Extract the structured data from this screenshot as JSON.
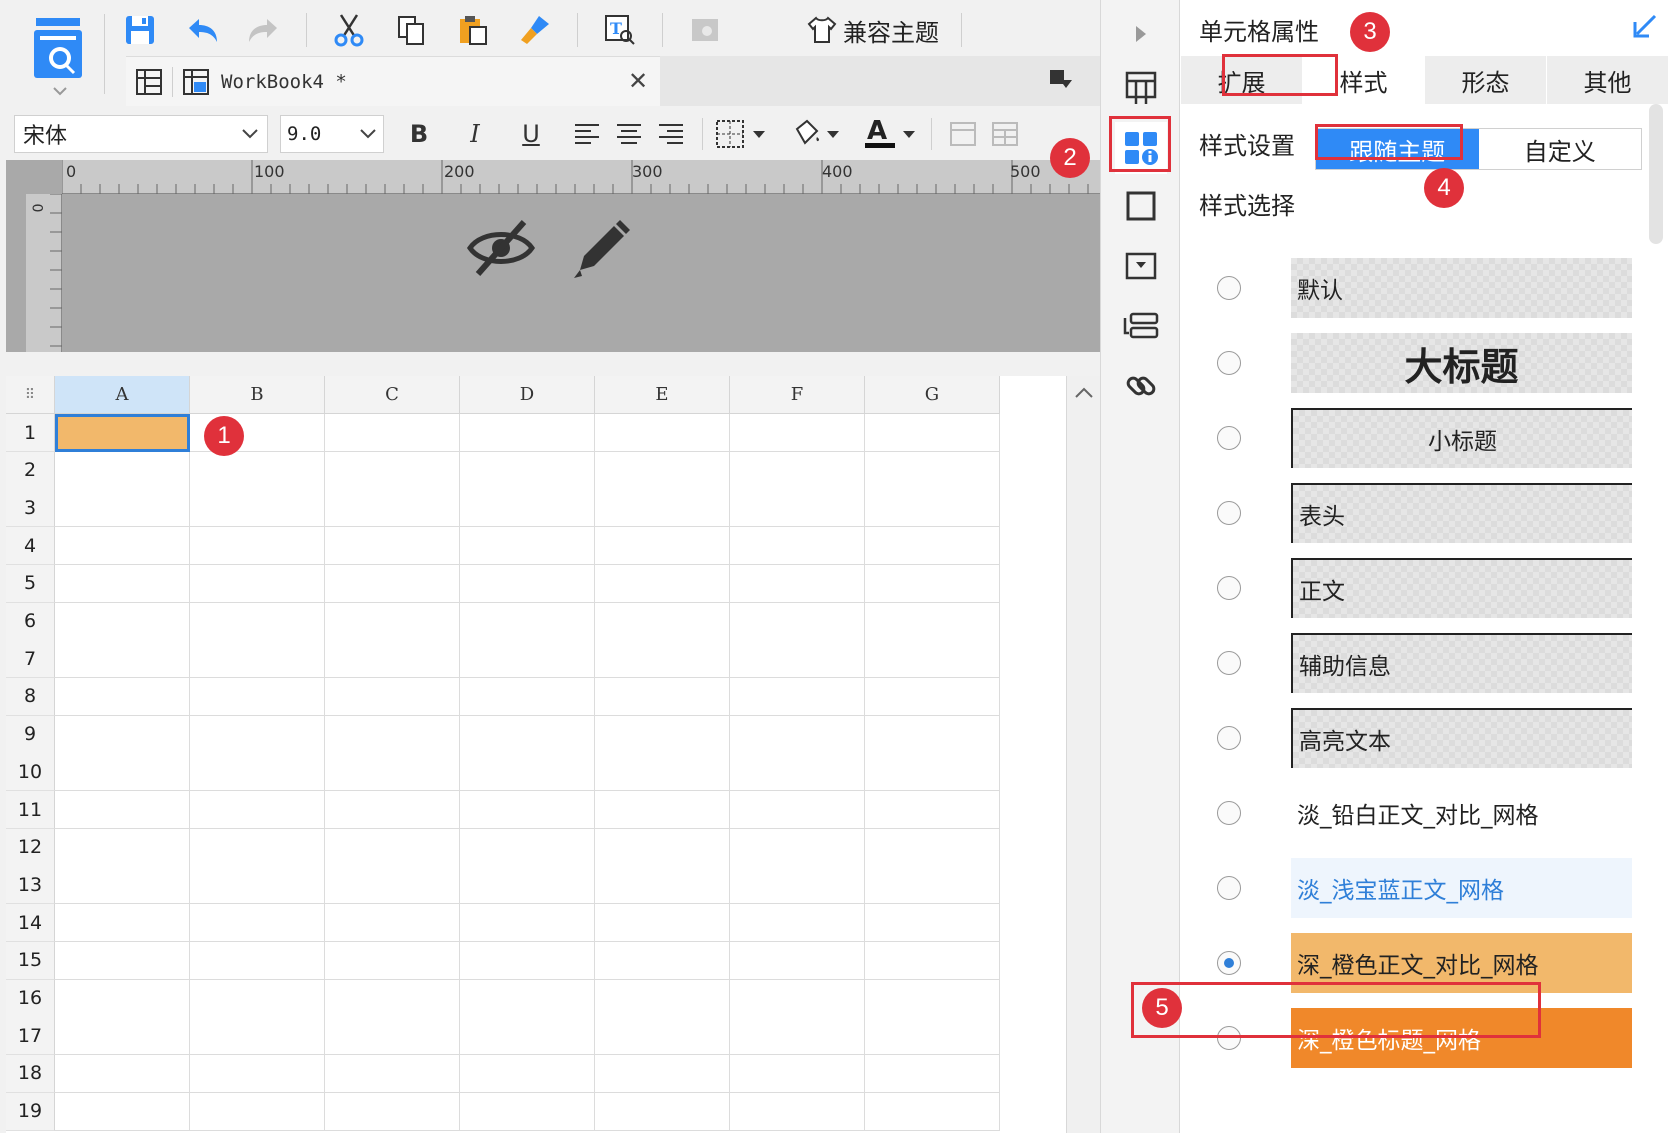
{
  "toolbar": {
    "theme_label": "兼容主题"
  },
  "tab": {
    "name": "WorkBook4 *"
  },
  "format": {
    "font_name": "宋体",
    "font_size": "9.0",
    "bold": "B",
    "italic": "I",
    "underline": "U",
    "font_color_glyph": "A"
  },
  "ruler": {
    "h_ticks": [
      "0",
      "100",
      "200",
      "300",
      "400",
      "500"
    ],
    "v_zero": "0"
  },
  "grid": {
    "columns": [
      "A",
      "B",
      "C",
      "D",
      "E",
      "F",
      "G"
    ],
    "rows": [
      "1",
      "2",
      "3",
      "4",
      "5",
      "6",
      "7",
      "8",
      "9",
      "10",
      "11",
      "12",
      "13",
      "14",
      "15",
      "16",
      "17",
      "18",
      "19"
    ],
    "selected_cell_color": "#f2b86b"
  },
  "panel": {
    "title": "单元格属性",
    "tabs": [
      "扩展",
      "样式",
      "形态",
      "其他"
    ],
    "active_tab": "样式",
    "style_setting_label": "样式设置",
    "style_setting_options": [
      "跟随主题",
      "自定义"
    ],
    "style_setting_selected": "跟随主题",
    "style_choice_label": "样式选择",
    "styles": [
      {
        "label": "默认",
        "selected": false
      },
      {
        "label": "大标题",
        "selected": false
      },
      {
        "label": "小标题",
        "selected": false
      },
      {
        "label": "表头",
        "selected": false
      },
      {
        "label": "正文",
        "selected": false
      },
      {
        "label": "辅助信息",
        "selected": false
      },
      {
        "label": "高亮文本",
        "selected": false
      },
      {
        "label": "淡_铅白正文_对比_网格",
        "selected": false
      },
      {
        "label": "淡_浅宝蓝正文_网格",
        "selected": false
      },
      {
        "label": "深_橙色正文_对比_网格",
        "selected": true
      },
      {
        "label": "深_橙色标题_网格",
        "selected": false
      }
    ]
  },
  "callouts": [
    "1",
    "2",
    "3",
    "4",
    "5"
  ],
  "colors": {
    "accent_blue": "#2f8af6",
    "callout_red": "#e0313b",
    "orange": "#f2b86b",
    "dark_orange": "#f0882a"
  }
}
